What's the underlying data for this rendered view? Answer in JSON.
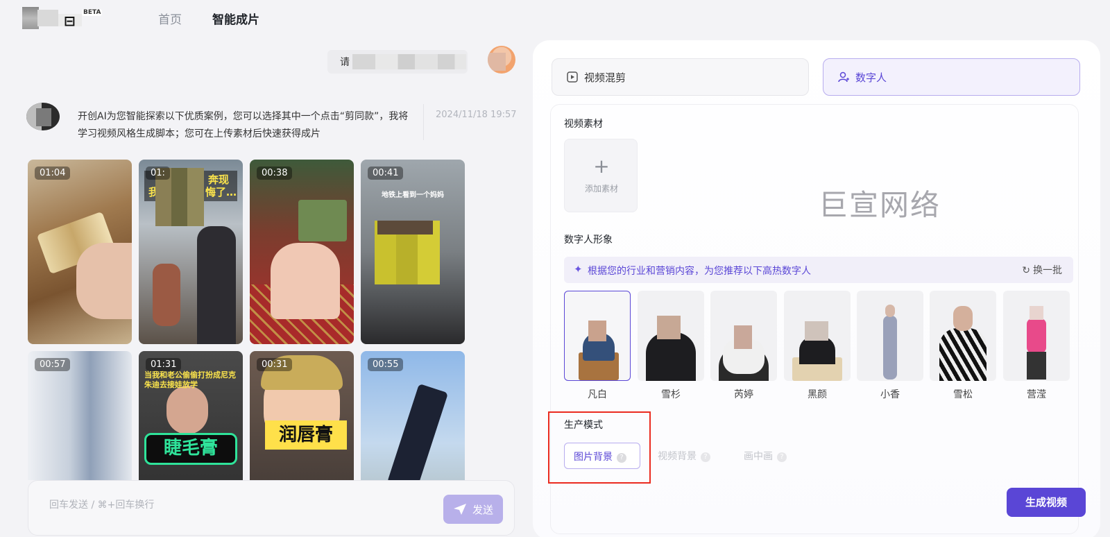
{
  "nav": {
    "badge": "BETA",
    "home": "首页",
    "smart": "智能成片"
  },
  "chat": {
    "user_message_prefix": "请",
    "ai_message": "开创AI为您智能探索以下优质案例，您可以选择其中一个点击“剪同款”，我将学习视频风格生成脚本；您可在上传素材后快速获得成片",
    "ai_time": "2024/11/18 19:57",
    "videos": [
      {
        "duration": "01:04",
        "overlay": ""
      },
      {
        "duration": "01:",
        "overlay": "我…悔了… 奔现"
      },
      {
        "duration": "00:38",
        "overlay": ""
      },
      {
        "duration": "00:41",
        "overlay": "地铁上看到一个妈妈"
      },
      {
        "duration": "00:57",
        "overlay": ""
      },
      {
        "duration": "01:31",
        "overlay": "当我和老公偷偷打扮成尼克朱迪去接娃放学"
      },
      {
        "duration": "00:31",
        "overlay": "润唇膏"
      },
      {
        "duration": "00:55",
        "overlay": ""
      }
    ],
    "c6_big": "睫毛膏",
    "composer_placeholder": "回车发送 / ⌘+回车换行",
    "send_label": "发送"
  },
  "panel": {
    "tab_mix": "视频混剪",
    "tab_digital_human": "数字人",
    "section_material": "视频素材",
    "add_material": "添加素材",
    "watermark": "巨宣网络",
    "section_avatar": "数字人形象",
    "recommend_text": "根据您的行业和营销内容，为您推荐以下高热数字人",
    "refresh": "换一批",
    "avatars": [
      "凡白",
      "雪杉",
      "芮婷",
      "黑颜",
      "小香",
      "雪松",
      "营滢"
    ],
    "section_mode": "生产模式",
    "modes": [
      "图片背景",
      "视频背景",
      "画中画"
    ],
    "generate": "生成视频"
  },
  "colors": {
    "accent": "#5a46d6",
    "highlight_box": "#ea2b1f",
    "send_disabled": "#b8b0ea"
  }
}
